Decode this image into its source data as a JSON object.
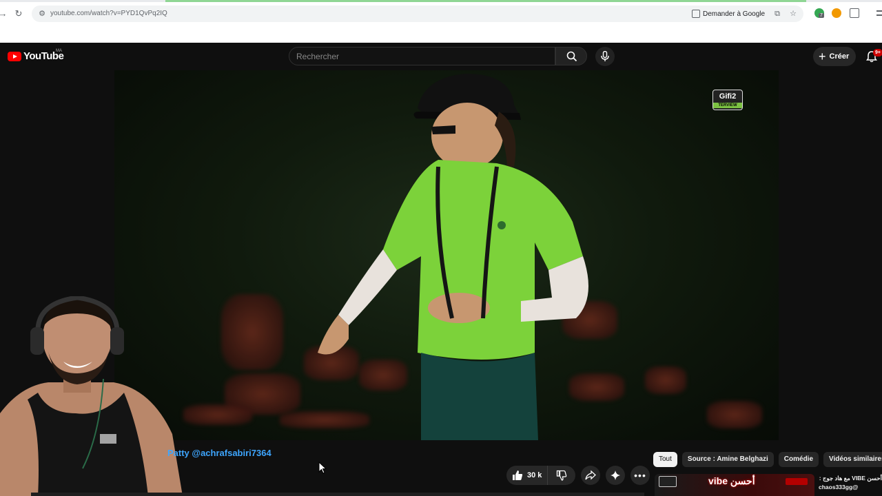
{
  "browser": {
    "url": "youtube.com/watch?v=PYD1QvPq2IQ",
    "ask_google": "Demander à Google",
    "profile_badge": "7"
  },
  "header": {
    "logo_text": "YouTube",
    "country_code": "MA",
    "search_placeholder": "Rechercher",
    "create_label": "Créer",
    "notification_count": "9+"
  },
  "video": {
    "watermark_text": "Gifi2",
    "watermark_sub": "TERVIEW"
  },
  "below_video": {
    "channel_line": "Patty @achrafsabiri7364",
    "like_count": "30 k"
  },
  "chips": [
    {
      "label": "Tout",
      "active": true
    },
    {
      "label": "Source : Amine Belghazi",
      "active": false
    },
    {
      "label": "Comédie",
      "active": false
    },
    {
      "label": "Vidéos similaires",
      "active": false
    }
  ],
  "recommendation": {
    "thumb_text": "vibe أحسن",
    "title": "أحسن VIBE مع هاد جوج :",
    "channel": "chaos333gg@"
  },
  "colors": {
    "accent_red": "#ff0000",
    "link_blue": "#3ea6ff",
    "shirt_green": "#7cd23a"
  }
}
